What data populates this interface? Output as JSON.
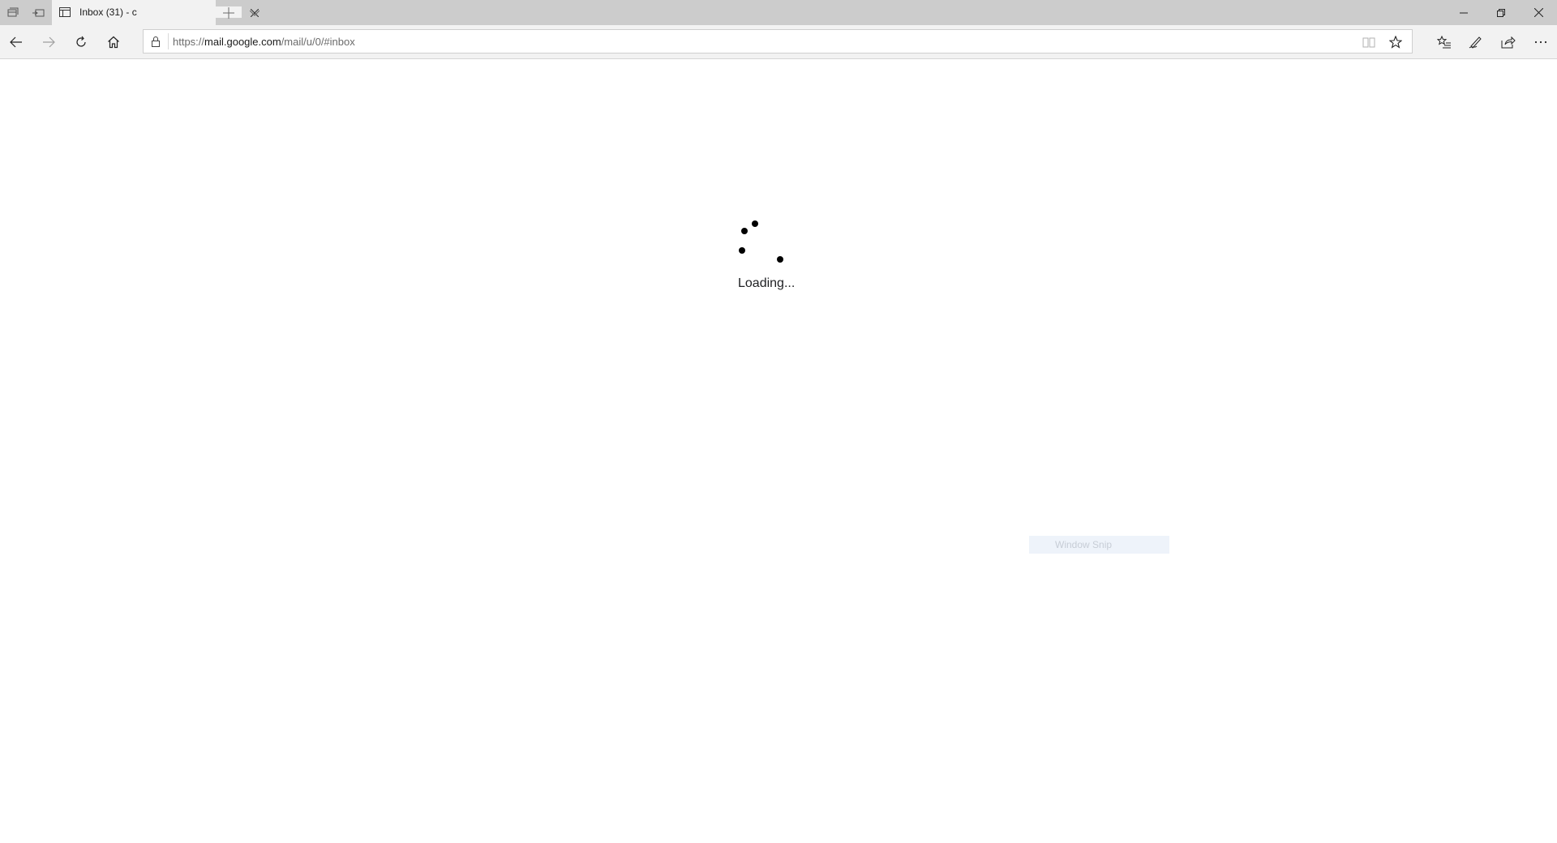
{
  "tab": {
    "title": "Inbox (31) - c",
    "favicon": "page-icon",
    "close": "close-icon"
  },
  "tabstrip": {
    "set_aside_icon": "tabs-aside-icon",
    "show_aside_icon": "tabs-preview-icon",
    "new_tab_icon": "plus-icon",
    "tab_previews_icon": "chevron-down-icon"
  },
  "window_controls": {
    "minimize": "minimize-icon",
    "restore": "restore-icon",
    "close": "close-icon"
  },
  "nav": {
    "back": "back-arrow-icon",
    "forward": "forward-arrow-icon",
    "refresh": "refresh-icon",
    "home": "home-icon"
  },
  "address": {
    "scheme": "https://",
    "host": "mail.google.com",
    "path": "/mail/u/0/#inbox",
    "reading_view_icon": "book-icon",
    "favorite_icon": "star-icon"
  },
  "toolbar": {
    "favorites_hub_icon": "favorites-list-icon",
    "notes_icon": "pen-icon",
    "share_icon": "share-icon",
    "more_icon": "ellipsis-icon"
  },
  "page": {
    "loading_text": "Loading...",
    "snip_hint": "Window Snip"
  },
  "colors": {
    "tabstrip_bg": "#cccccc",
    "toolbar_bg": "#f2f2f2",
    "page_bg": "#ffffff",
    "spinner_dot": "#000000"
  }
}
